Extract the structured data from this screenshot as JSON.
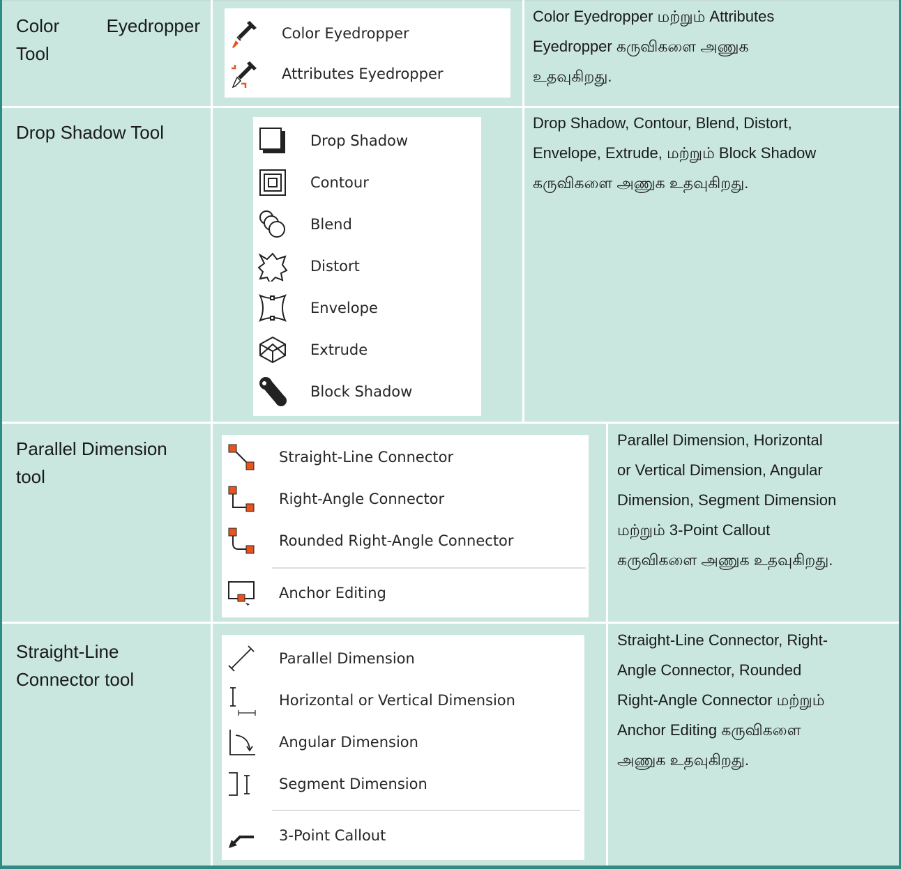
{
  "rows": [
    {
      "name": "Color Eyedropper Tool",
      "name_lines": [
        "Color Eyedropper",
        "Tool"
      ],
      "items": [
        "Color Eyedropper",
        "Attributes Eyedropper"
      ],
      "description_lines": [
        "Color Eyedropper மற்றும் Attributes",
        "Eyedropper கருவிகளை அணுக",
        "உதவுகிறது."
      ]
    },
    {
      "name": "Drop Shadow Tool",
      "items": [
        "Drop Shadow",
        "Contour",
        "Blend",
        "Distort",
        "Envelope",
        "Extrude",
        "Block Shadow"
      ],
      "description_lines": [
        "Drop Shadow, Contour, Blend, Distort,",
        "Envelope, Extrude, மற்றும் Block Shadow",
        "கருவிகளை அணுக உதவுகிறது."
      ]
    },
    {
      "name_lines": [
        "Parallel Dimension",
        "tool"
      ],
      "items": [
        "Straight-Line Connector",
        "Right-Angle Connector",
        "Rounded Right-Angle Connector",
        "Anchor Editing"
      ],
      "description_lines": [
        "Parallel Dimension, Horizontal",
        "or Vertical Dimension, Angular",
        "Dimension, Segment Dimension",
        "மற்றும் 3-Point Callout",
        "கருவிகளை அணுக உதவுகிறது."
      ]
    },
    {
      "name_lines": [
        "Straight-Line",
        "Connector tool"
      ],
      "items": [
        "Parallel Dimension",
        "Horizontal or Vertical Dimension",
        "Angular Dimension",
        "Segment Dimension",
        "3-Point Callout"
      ],
      "description_lines": [
        "Straight-Line Connector, Right-",
        "Angle Connector, Rounded",
        "Right-Angle Connector மற்றும்",
        "Anchor Editing கருவிகளை",
        "அணுக உதவுகிறது."
      ]
    }
  ],
  "colors": {
    "background": "#c9e6df",
    "frame": "#2e8b86",
    "grid": "#ffffff",
    "accent": "#e8541c"
  },
  "icons": {
    "row1": [
      "eyedropper-icon",
      "attributes-eyedropper-icon"
    ],
    "row2": [
      "drop-shadow-icon",
      "contour-icon",
      "blend-icon",
      "distort-icon",
      "envelope-icon",
      "extrude-icon",
      "block-shadow-icon"
    ],
    "row3": [
      "straight-line-connector-icon",
      "right-angle-connector-icon",
      "rounded-right-angle-connector-icon",
      "anchor-editing-icon"
    ],
    "row4": [
      "parallel-dimension-icon",
      "horizontal-vertical-dimension-icon",
      "angular-dimension-icon",
      "segment-dimension-icon",
      "callout-icon"
    ]
  }
}
